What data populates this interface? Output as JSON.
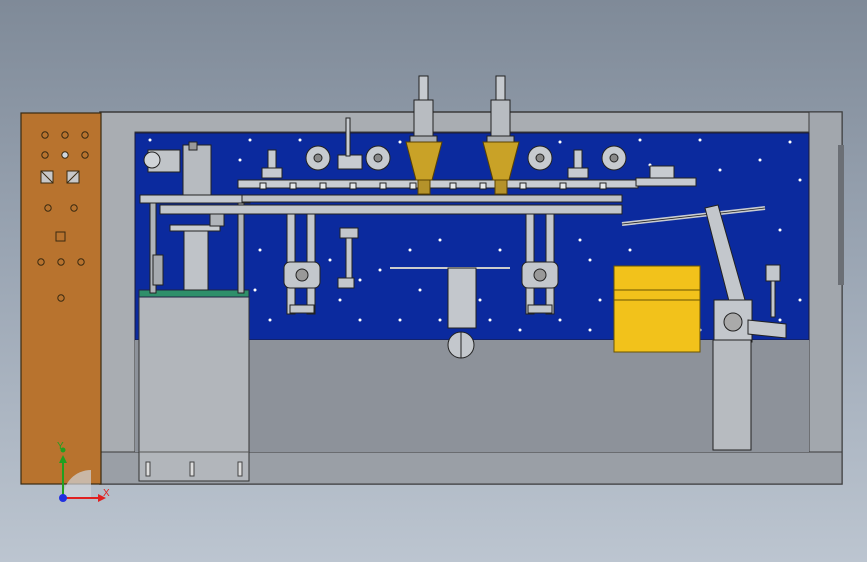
{
  "viewport": {
    "triad": {
      "x_label": "X",
      "y_label": "Y"
    }
  },
  "colors": {
    "background_top": "#7f8a98",
    "background_bottom": "#bcc5d0",
    "frame_gray": "#a8adb3",
    "panel_blue": "#0b2a9e",
    "side_panel_orange": "#b8732e",
    "nozzle_gold": "#c9a227",
    "box_yellow": "#f2c21b",
    "triad_x": "#e02020",
    "triad_y": "#20a020",
    "triad_z": "#2030e0"
  }
}
